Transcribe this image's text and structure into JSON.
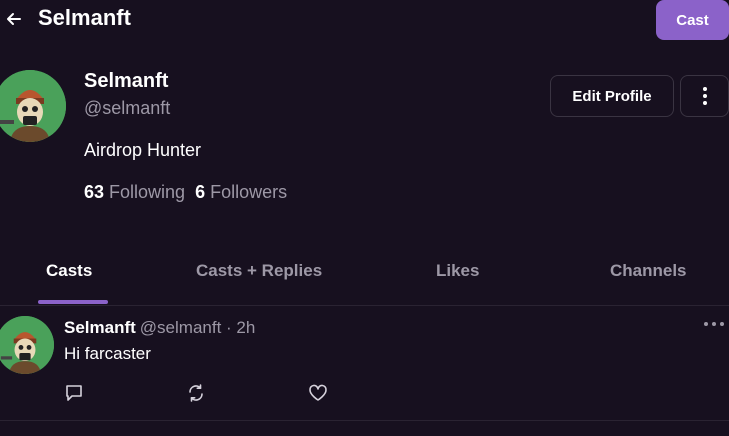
{
  "header": {
    "title": "Selmanft",
    "cast_button": "Cast"
  },
  "profile": {
    "display_name": "Selmanft",
    "handle": "@selmanft",
    "bio": "Airdrop Hunter",
    "following_count": "63",
    "following_label": "Following",
    "followers_count": "6",
    "followers_label": "Followers",
    "edit_button": "Edit Profile"
  },
  "tabs": [
    {
      "label": "Casts",
      "active": true
    },
    {
      "label": "Casts + Replies",
      "active": false
    },
    {
      "label": "Likes",
      "active": false
    },
    {
      "label": "Channels",
      "active": false
    }
  ],
  "casts": [
    {
      "author": "Selmanft",
      "meta": "@selmanft · 2h",
      "text": "Hi farcaster"
    }
  ],
  "icons": {
    "back": "arrow-left-icon",
    "more": "vertical-dots-icon",
    "cast_menu": "horizontal-dots-icon",
    "reply": "comment-icon",
    "recast": "recast-icon",
    "like": "heart-icon"
  },
  "colors": {
    "background": "#17101f",
    "accent": "#8b62c9",
    "muted_text": "#9d98a6",
    "border": "#2a2332",
    "avatar_bg": "#4aa15a"
  }
}
